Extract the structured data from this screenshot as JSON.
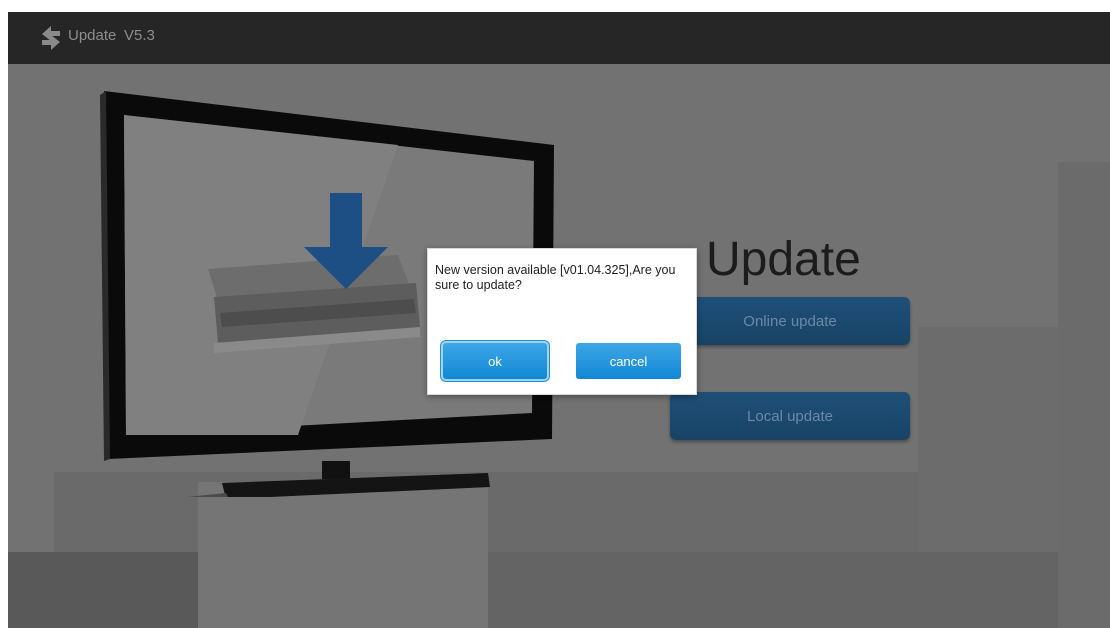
{
  "titlebar": {
    "title": "Update",
    "version": "V5.3"
  },
  "main": {
    "heading": "Update",
    "online_update_label": "Online update",
    "local_update_label": "Local update"
  },
  "dialog": {
    "message": "New version available [v01.04.325],Are you sure to update?",
    "ok_label": "ok",
    "cancel_label": "cancel"
  },
  "colors": {
    "background": "#6f6f6f",
    "titlebar": "#262626",
    "button_dim": "#1f4f78",
    "button_active": "#1287d4"
  },
  "icons": [
    "sync-arrows-icon",
    "download-arrow-icon"
  ]
}
